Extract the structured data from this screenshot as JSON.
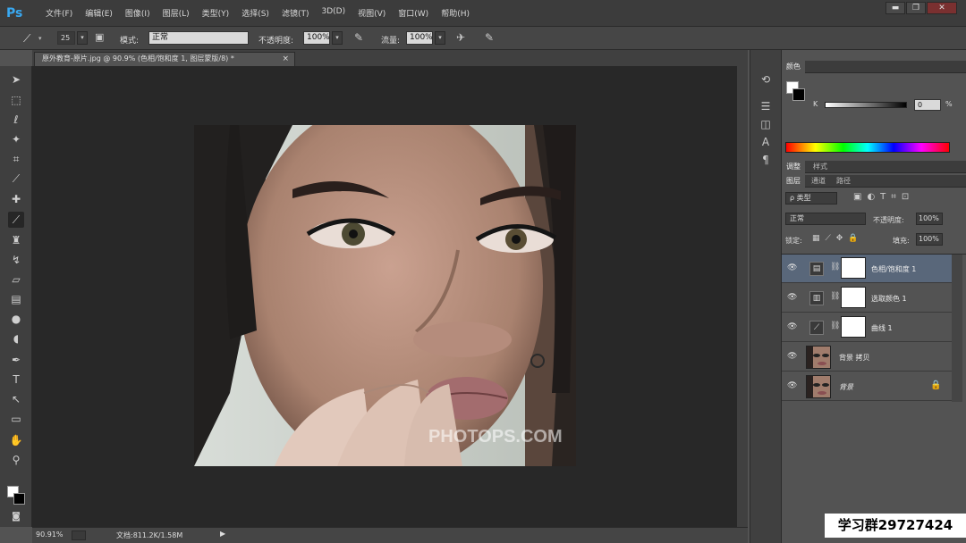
{
  "app": {
    "logo": "Ps"
  },
  "menu": [
    "文件(F)",
    "编辑(E)",
    "图像(I)",
    "图层(L)",
    "类型(Y)",
    "选择(S)",
    "滤镜(T)",
    "3D(D)",
    "视图(V)",
    "窗口(W)",
    "帮助(H)"
  ],
  "window_controls": {
    "minimize": "▬",
    "restore": "❐",
    "close": "✕"
  },
  "options": {
    "brush_size": "25",
    "mode_label": "模式:",
    "mode_value": "正常",
    "opacity_label": "不透明度:",
    "opacity_value": "100%",
    "flow_label": "流量:",
    "flow_value": "100%"
  },
  "document_tab": {
    "title": "原外教育-原片.jpg @ 90.9% (色相/饱和度 1, 图层蒙版/8) *",
    "close": "×"
  },
  "canvas": {
    "watermark": "PHOTOPS.COM"
  },
  "status": {
    "zoom": "90.91%",
    "doc_info": "文档:811.2K/1.58M"
  },
  "color_panel": {
    "tab": "颜色",
    "channel_label": "K",
    "value": "0",
    "unit": "%"
  },
  "adjust_tabs": [
    "调整",
    "样式"
  ],
  "layers_tabs": [
    "图层",
    "通道",
    "路径"
  ],
  "layers_panel": {
    "filter_kind": "ρ 类型",
    "blend_mode": "正常",
    "opacity_label": "不透明度:",
    "opacity_value": "100%",
    "lock_label": "锁定:",
    "fill_label": "填充:",
    "fill_value": "100%"
  },
  "layers": [
    {
      "name": "色相/饱和度 1",
      "type": "adjustment",
      "selected": true
    },
    {
      "name": "选取颜色 1",
      "type": "adjustment",
      "selected": false
    },
    {
      "name": "曲线 1",
      "type": "adjustment",
      "selected": false
    },
    {
      "name": "背景 拷贝",
      "type": "photo",
      "selected": false
    },
    {
      "name": "背景",
      "type": "photo",
      "selected": false,
      "locked": true
    }
  ],
  "overlay": {
    "qq_group": "学习群29727424"
  }
}
